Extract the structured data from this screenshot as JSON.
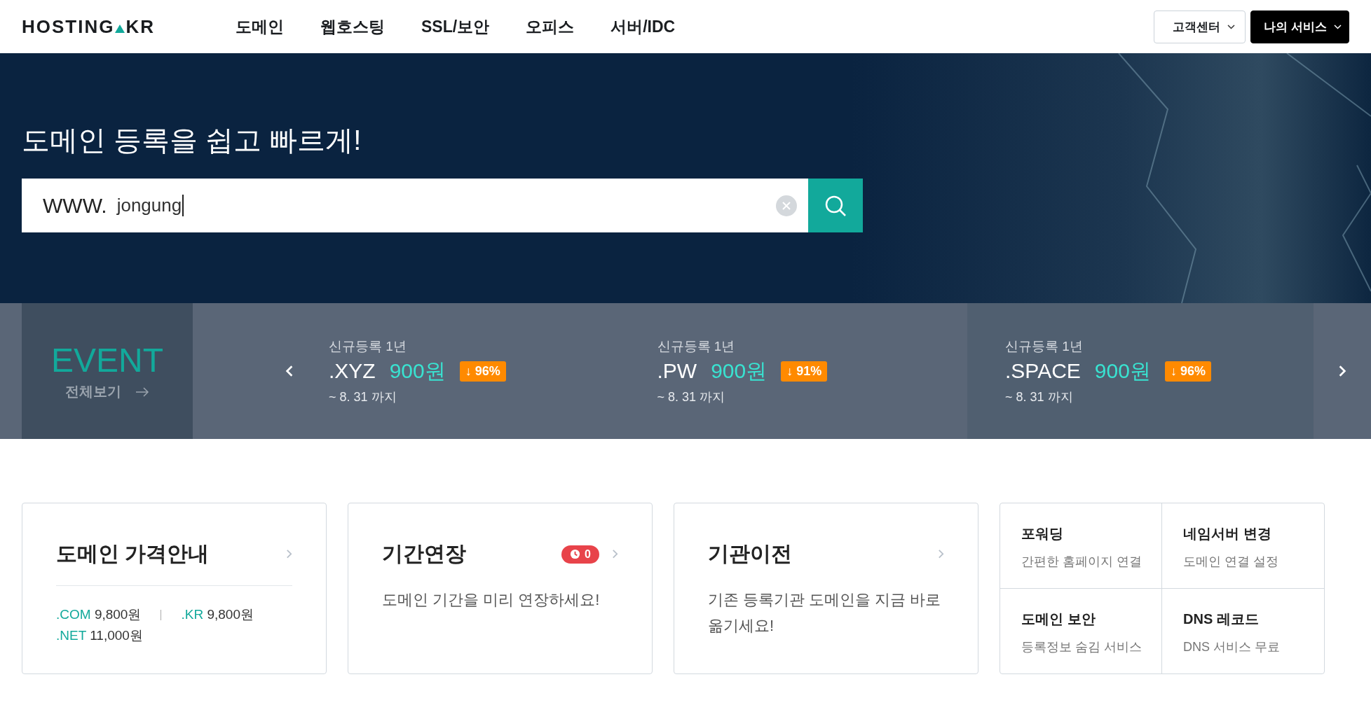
{
  "header": {
    "logo": {
      "left": "HOSTING",
      "right": "KR"
    },
    "nav": [
      {
        "label": "도메인"
      },
      {
        "label": "웹호스팅"
      },
      {
        "label": "SSL/보안"
      },
      {
        "label": "오피스"
      },
      {
        "label": "서버/IDC"
      }
    ],
    "buttons": [
      {
        "label": "고객센터",
        "kind": "outline"
      },
      {
        "label": "나의 서비스",
        "kind": "solid"
      }
    ]
  },
  "hero": {
    "title": "도메인 등록을 쉽고 빠르게!",
    "search": {
      "prefix": "WWW.",
      "value": "jongung"
    }
  },
  "event": {
    "title": "EVENT",
    "link": "전체보기",
    "items": [
      {
        "label": "신규등록 1년",
        "tld": ".XYZ",
        "price": "900원",
        "discount": "↓ 96%",
        "until": "~ 8. 31 까지",
        "selected": false
      },
      {
        "label": "신규등록 1년",
        "tld": ".PW",
        "price": "900원",
        "discount": "↓ 91%",
        "until": "~ 8. 31 까지",
        "selected": false
      },
      {
        "label": "신규등록 1년",
        "tld": ".SPACE",
        "price": "900원",
        "discount": "↓ 96%",
        "until": "~ 8. 31 까지",
        "selected": true
      }
    ]
  },
  "cards": [
    {
      "kind": "prices",
      "title": "도메인 가격안내",
      "prices": [
        {
          "tld": ".COM",
          "price": "9,800원"
        },
        {
          "tld": ".KR",
          "price": "9,800원"
        },
        {
          "tld": ".NET",
          "price": "11,000원"
        }
      ]
    },
    {
      "kind": "text",
      "title": "기간연장",
      "badge": "0",
      "text": "도메인 기간을 미리 연장하세요!"
    },
    {
      "kind": "text",
      "title": "기관이전",
      "text": "기존 등록기관 도메인을 지금 바로 옮기세요!"
    }
  ],
  "services": [
    {
      "title": "포워딩",
      "text": "간편한 홈페이지 연결"
    },
    {
      "title": "네임서버 변경",
      "text": "도메인 연결 설정"
    },
    {
      "title": "도메인 보안",
      "text": "등록정보 숨김 서비스"
    },
    {
      "title": "DNS 레코드",
      "text": "DNS 서비스 무료"
    }
  ]
}
